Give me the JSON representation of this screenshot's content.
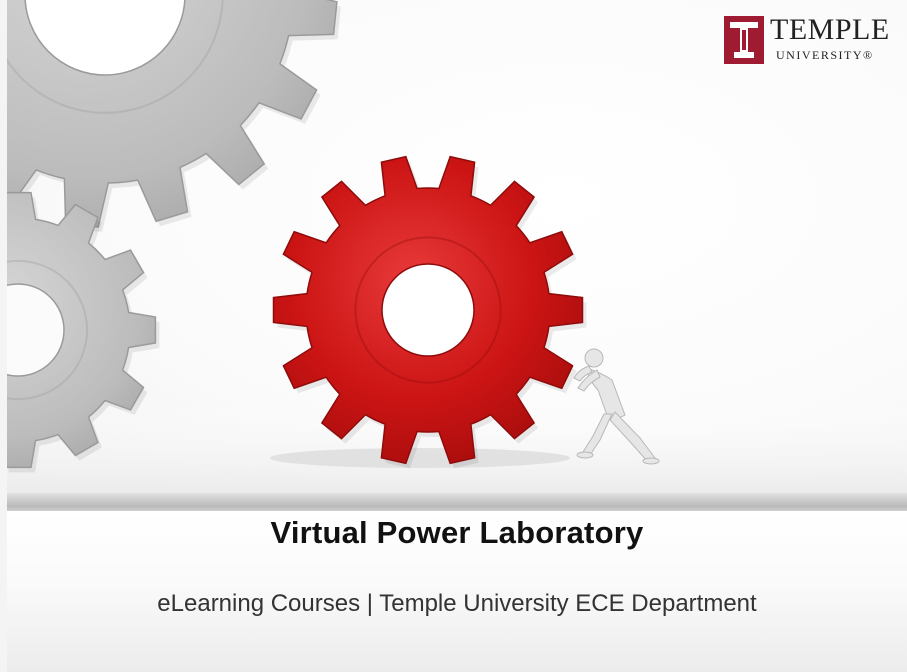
{
  "slide": {
    "title": "Virtual Power Laboratory",
    "subtitle": "eLearning Courses | Temple University ECE Department"
  },
  "logo": {
    "wordmark": "TEMPLE",
    "subtext": "UNIVERSITY®",
    "brand_color": "#9e1b32"
  },
  "illustration": {
    "primary_gear": "red-gear-icon",
    "secondary_gears": [
      "large-gray-gear-icon",
      "small-gray-gear-icon"
    ],
    "figure": "pushing-figure-icon",
    "accent_color": "#d01818",
    "gear_gray": "#bdbdbd"
  }
}
